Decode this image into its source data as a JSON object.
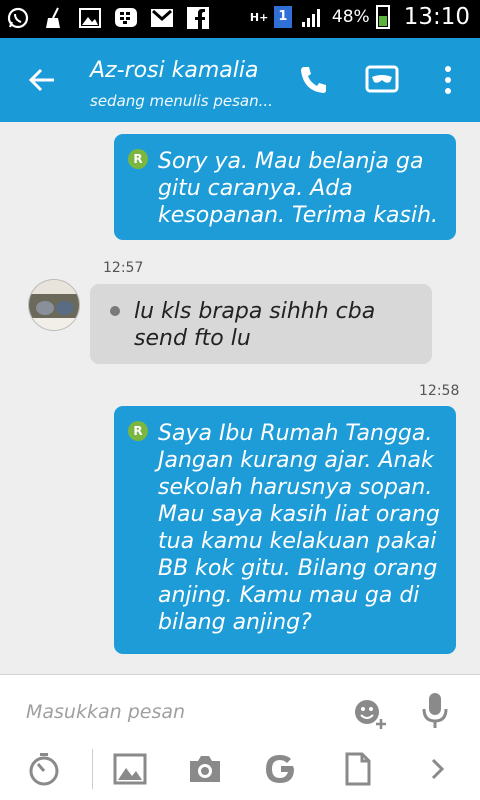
{
  "status_bar": {
    "network_type": "H+",
    "sim_slot": "1",
    "battery_percent": "48%",
    "battery_level": 0.48,
    "time": "13:10",
    "icons": [
      "whatsapp-icon",
      "broom-icon",
      "image-icon",
      "bbm-icon",
      "gmail-icon",
      "facebook-icon",
      "signal-icon"
    ]
  },
  "header": {
    "contact_name": "Az-rosi kamalia",
    "status": "sedang menulis pesan...",
    "color": "#1a9bd7"
  },
  "messages": [
    {
      "direction": "out",
      "read_mark": "R",
      "text": "Sory ya. Mau belanja ga gitu caranya. Ada kesopanan. Terima kasih."
    },
    {
      "direction": "in",
      "time": "12:57",
      "text": "lu kls brapa sihhh cba send fto lu"
    },
    {
      "direction": "out",
      "time": "12:58",
      "read_mark": "R",
      "text": "Saya Ibu Rumah Tangga. Jangan kurang ajar. Anak sekolah harusnya sopan. Mau saya kasih liat orang tua kamu kelakuan pakai BB kok gitu. Bilang orang anjing. Kamu mau ga di bilang anjing?"
    }
  ],
  "composer": {
    "placeholder": "Masukkan pesan"
  },
  "colors": {
    "outgoing_bubble": "#1e9cd7",
    "incoming_bubble": "#d8d8d8",
    "read_badge": "#7ab640"
  }
}
